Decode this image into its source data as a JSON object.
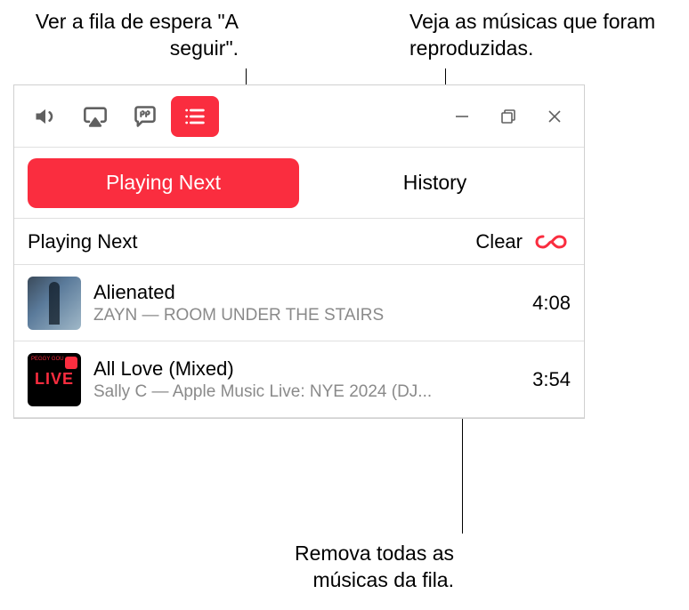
{
  "callouts": {
    "queue": "Ver a fila de espera \"A seguir\".",
    "history": "Veja as músicas que foram reproduzidas.",
    "clear": "Remova todas as músicas da fila."
  },
  "tabs": {
    "playing_next": "Playing Next",
    "history": "History"
  },
  "section": {
    "title": "Playing Next",
    "clear": "Clear"
  },
  "tracks": [
    {
      "title": "Alienated",
      "artist": "ZAYN — ROOM UNDER THE STAIRS",
      "duration": "4:08"
    },
    {
      "title": "All Love (Mixed)",
      "artist": "Sally C — Apple Music Live: NYE 2024 (DJ...",
      "duration": "3:54"
    }
  ],
  "art2_text": "LIVE"
}
